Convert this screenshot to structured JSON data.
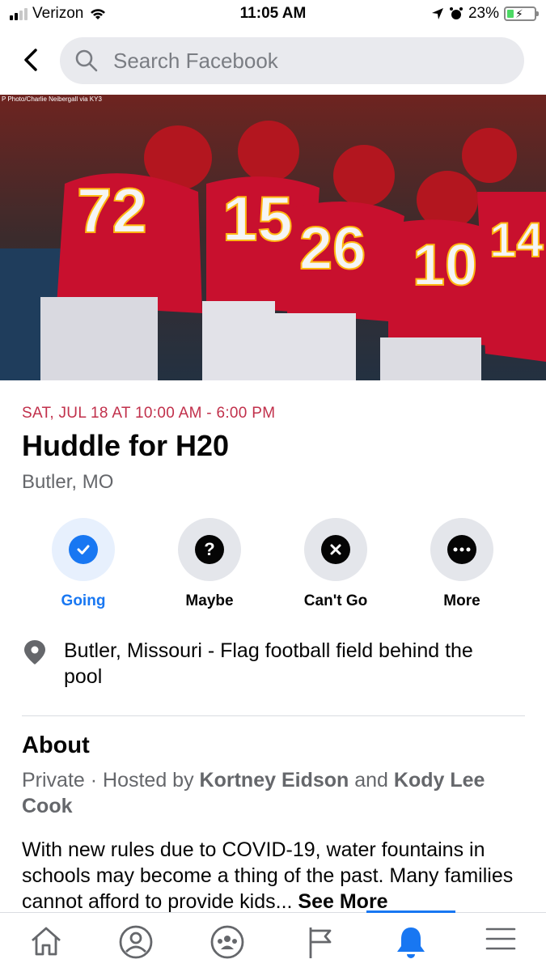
{
  "status_bar": {
    "carrier": "Verizon",
    "time": "11:05 AM",
    "battery": "23%"
  },
  "search": {
    "placeholder": "Search Facebook"
  },
  "cover": {
    "photo_credit": "P Photo/Charlie Neibergall via KY3"
  },
  "event": {
    "date": "SAT, JUL 18 AT 10:00 AM - 6:00 PM",
    "title": "Huddle for H20",
    "city": "Butler, MO"
  },
  "actions": [
    {
      "label": "Going",
      "icon": "check-icon",
      "active": true
    },
    {
      "label": "Maybe",
      "icon": "question-icon"
    },
    {
      "label": "Can't Go",
      "icon": "x-icon"
    },
    {
      "label": "More",
      "icon": "ellipsis-icon"
    }
  ],
  "location": "Butler, Missouri - Flag football field behind the pool",
  "about": {
    "heading": "About",
    "privacy": "Private",
    "hosted_prefix": " · Hosted by ",
    "host1": "Kortney Eidson",
    "and": " and ",
    "host2": "Kody Lee Cook",
    "description": "With new rules due to COVID-19, water fountains in schools may become a thing of the past. Many families cannot afford to provide kids...",
    "see_more": "See More"
  },
  "tabbar": [
    "home-icon",
    "profile-icon",
    "groups-icon",
    "pages-icon",
    "notifications-icon",
    "menu-icon"
  ],
  "colors": {
    "accent": "#1877f2",
    "date": "#c1304b",
    "secondary_text": "#65676b"
  }
}
